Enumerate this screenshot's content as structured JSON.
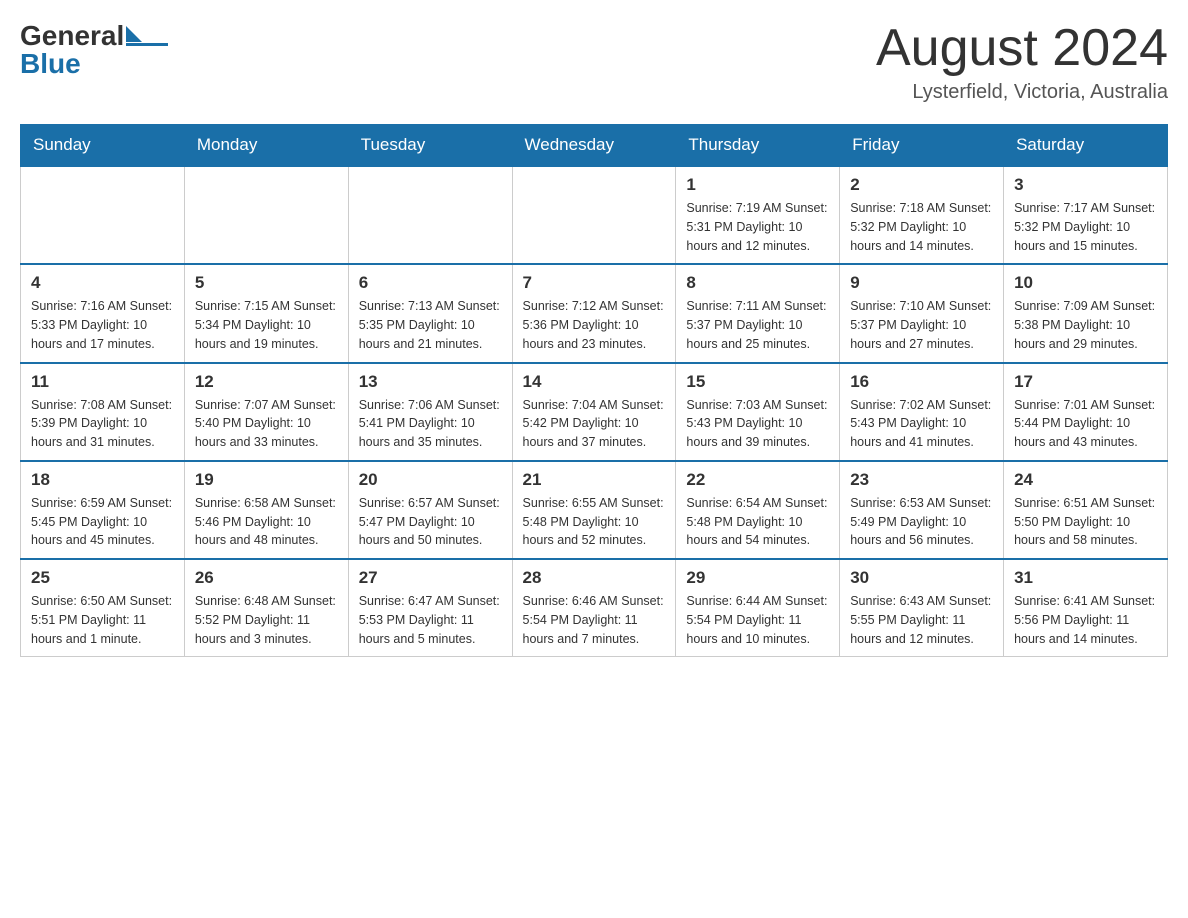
{
  "header": {
    "logo_general": "General",
    "logo_blue": "Blue",
    "month_title": "August 2024",
    "location": "Lysterfield, Victoria, Australia"
  },
  "days_of_week": [
    "Sunday",
    "Monday",
    "Tuesday",
    "Wednesday",
    "Thursday",
    "Friday",
    "Saturday"
  ],
  "weeks": [
    {
      "days": [
        {
          "date": "",
          "info": ""
        },
        {
          "date": "",
          "info": ""
        },
        {
          "date": "",
          "info": ""
        },
        {
          "date": "",
          "info": ""
        },
        {
          "date": "1",
          "info": "Sunrise: 7:19 AM\nSunset: 5:31 PM\nDaylight: 10 hours and 12 minutes."
        },
        {
          "date": "2",
          "info": "Sunrise: 7:18 AM\nSunset: 5:32 PM\nDaylight: 10 hours and 14 minutes."
        },
        {
          "date": "3",
          "info": "Sunrise: 7:17 AM\nSunset: 5:32 PM\nDaylight: 10 hours and 15 minutes."
        }
      ]
    },
    {
      "days": [
        {
          "date": "4",
          "info": "Sunrise: 7:16 AM\nSunset: 5:33 PM\nDaylight: 10 hours and 17 minutes."
        },
        {
          "date": "5",
          "info": "Sunrise: 7:15 AM\nSunset: 5:34 PM\nDaylight: 10 hours and 19 minutes."
        },
        {
          "date": "6",
          "info": "Sunrise: 7:13 AM\nSunset: 5:35 PM\nDaylight: 10 hours and 21 minutes."
        },
        {
          "date": "7",
          "info": "Sunrise: 7:12 AM\nSunset: 5:36 PM\nDaylight: 10 hours and 23 minutes."
        },
        {
          "date": "8",
          "info": "Sunrise: 7:11 AM\nSunset: 5:37 PM\nDaylight: 10 hours and 25 minutes."
        },
        {
          "date": "9",
          "info": "Sunrise: 7:10 AM\nSunset: 5:37 PM\nDaylight: 10 hours and 27 minutes."
        },
        {
          "date": "10",
          "info": "Sunrise: 7:09 AM\nSunset: 5:38 PM\nDaylight: 10 hours and 29 minutes."
        }
      ]
    },
    {
      "days": [
        {
          "date": "11",
          "info": "Sunrise: 7:08 AM\nSunset: 5:39 PM\nDaylight: 10 hours and 31 minutes."
        },
        {
          "date": "12",
          "info": "Sunrise: 7:07 AM\nSunset: 5:40 PM\nDaylight: 10 hours and 33 minutes."
        },
        {
          "date": "13",
          "info": "Sunrise: 7:06 AM\nSunset: 5:41 PM\nDaylight: 10 hours and 35 minutes."
        },
        {
          "date": "14",
          "info": "Sunrise: 7:04 AM\nSunset: 5:42 PM\nDaylight: 10 hours and 37 minutes."
        },
        {
          "date": "15",
          "info": "Sunrise: 7:03 AM\nSunset: 5:43 PM\nDaylight: 10 hours and 39 minutes."
        },
        {
          "date": "16",
          "info": "Sunrise: 7:02 AM\nSunset: 5:43 PM\nDaylight: 10 hours and 41 minutes."
        },
        {
          "date": "17",
          "info": "Sunrise: 7:01 AM\nSunset: 5:44 PM\nDaylight: 10 hours and 43 minutes."
        }
      ]
    },
    {
      "days": [
        {
          "date": "18",
          "info": "Sunrise: 6:59 AM\nSunset: 5:45 PM\nDaylight: 10 hours and 45 minutes."
        },
        {
          "date": "19",
          "info": "Sunrise: 6:58 AM\nSunset: 5:46 PM\nDaylight: 10 hours and 48 minutes."
        },
        {
          "date": "20",
          "info": "Sunrise: 6:57 AM\nSunset: 5:47 PM\nDaylight: 10 hours and 50 minutes."
        },
        {
          "date": "21",
          "info": "Sunrise: 6:55 AM\nSunset: 5:48 PM\nDaylight: 10 hours and 52 minutes."
        },
        {
          "date": "22",
          "info": "Sunrise: 6:54 AM\nSunset: 5:48 PM\nDaylight: 10 hours and 54 minutes."
        },
        {
          "date": "23",
          "info": "Sunrise: 6:53 AM\nSunset: 5:49 PM\nDaylight: 10 hours and 56 minutes."
        },
        {
          "date": "24",
          "info": "Sunrise: 6:51 AM\nSunset: 5:50 PM\nDaylight: 10 hours and 58 minutes."
        }
      ]
    },
    {
      "days": [
        {
          "date": "25",
          "info": "Sunrise: 6:50 AM\nSunset: 5:51 PM\nDaylight: 11 hours and 1 minute."
        },
        {
          "date": "26",
          "info": "Sunrise: 6:48 AM\nSunset: 5:52 PM\nDaylight: 11 hours and 3 minutes."
        },
        {
          "date": "27",
          "info": "Sunrise: 6:47 AM\nSunset: 5:53 PM\nDaylight: 11 hours and 5 minutes."
        },
        {
          "date": "28",
          "info": "Sunrise: 6:46 AM\nSunset: 5:54 PM\nDaylight: 11 hours and 7 minutes."
        },
        {
          "date": "29",
          "info": "Sunrise: 6:44 AM\nSunset: 5:54 PM\nDaylight: 11 hours and 10 minutes."
        },
        {
          "date": "30",
          "info": "Sunrise: 6:43 AM\nSunset: 5:55 PM\nDaylight: 11 hours and 12 minutes."
        },
        {
          "date": "31",
          "info": "Sunrise: 6:41 AM\nSunset: 5:56 PM\nDaylight: 11 hours and 14 minutes."
        }
      ]
    }
  ]
}
